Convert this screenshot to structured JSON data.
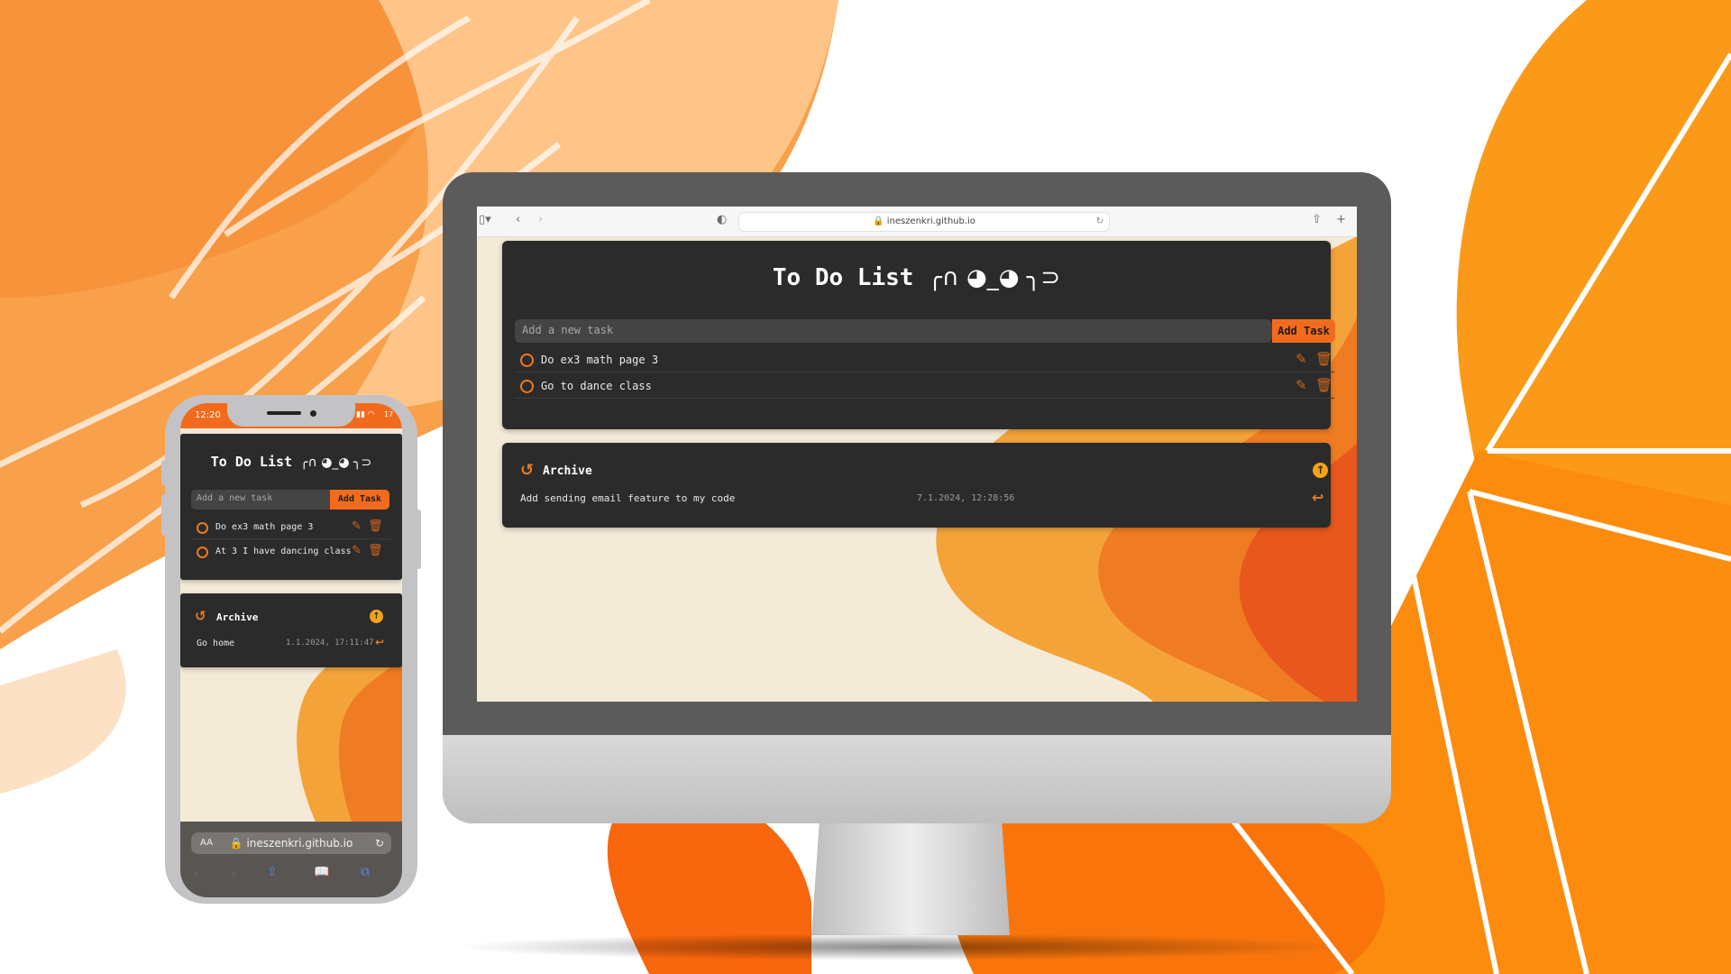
{
  "desktop": {
    "browser": {
      "url": "ineszenkri.github.io"
    },
    "todo": {
      "title": "To Do List",
      "face": "╭∩ ◕_◕ ╮⊃",
      "input_placeholder": "Add a new task",
      "add_button": "Add Task",
      "tasks": [
        {
          "label": "Do ex3 math page 3"
        },
        {
          "label": "Go to dance class"
        }
      ]
    },
    "archive": {
      "title": "Archive",
      "items": [
        {
          "label": "Add sending email feature to my code",
          "time": "7.1.2024, 12:28:56"
        }
      ]
    }
  },
  "phone": {
    "status": {
      "time": "12:20",
      "battery": "17"
    },
    "todo": {
      "title": "To Do List",
      "face": "╭∩ ◕_◕ ╮⊃",
      "input_placeholder": "Add a new task",
      "add_button": "Add Task",
      "tasks": [
        {
          "label": "Do ex3 math page 3"
        },
        {
          "label": "At 3 I have dancing class"
        }
      ]
    },
    "archive": {
      "title": "Archive",
      "items": [
        {
          "label": "Go home",
          "time": "1.1.2024, 17:11:47"
        }
      ]
    },
    "address_bar": {
      "aa": "AA",
      "url": "ineszenkri.github.io"
    }
  },
  "colors": {
    "accent": "#f26b1d",
    "card": "#2b2b2b",
    "amber": "#f5a416"
  }
}
